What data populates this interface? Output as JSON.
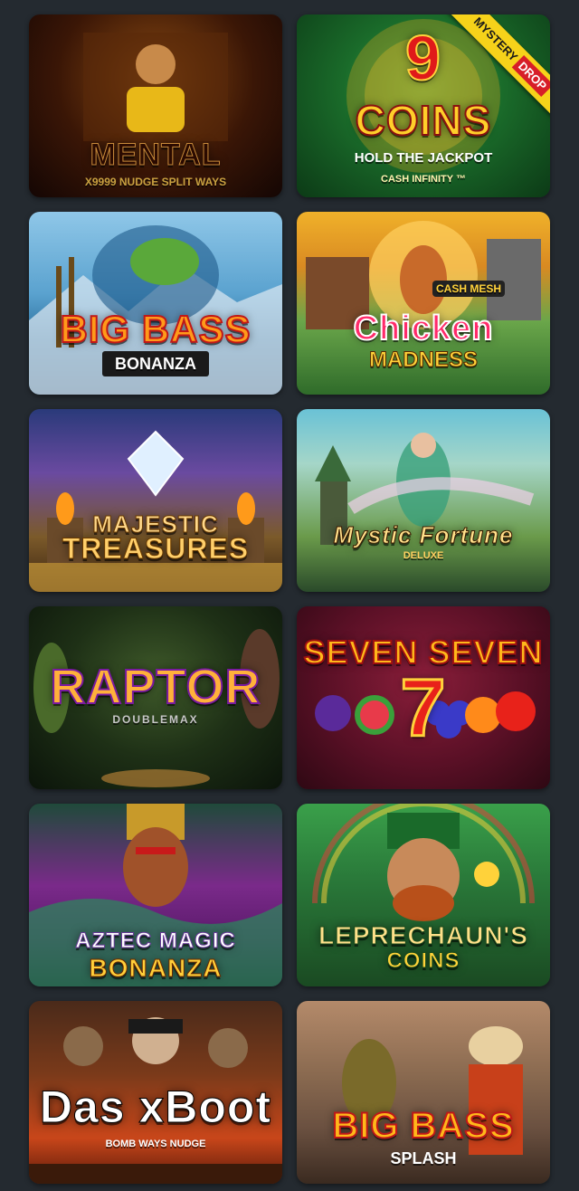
{
  "games": [
    {
      "title": "MENTAL",
      "sub": "X9999  NUDGE  SPLIT  WAYS"
    },
    {
      "title": "COINS",
      "badge_number": "9",
      "sub": "HOLD THE JACKPOT",
      "sub2": "CASH INFINITY ™",
      "ribbon_a": "MYSTERY ",
      "ribbon_b": "DROP"
    },
    {
      "title": "BIG BASS",
      "sub": "BONANZA"
    },
    {
      "title": "Chicken",
      "sub": "MADNESS",
      "sub2": "CASH MESH"
    },
    {
      "title": "MAJESTIC",
      "sub": "TREASURES"
    },
    {
      "title": "Mystic Fortune",
      "sub": "DELUXE"
    },
    {
      "title": "RAPTOR",
      "sub": "DOUBLEMAX"
    },
    {
      "title": "SEVEN SEVEN",
      "sub": "7"
    },
    {
      "title": "AZTEC MAGIC",
      "sub": "BONANZA"
    },
    {
      "title": "LEPRECHAUN'S",
      "sub": "COINS"
    },
    {
      "title": "Das xBoot",
      "sub": "BOMB  WAYS  NUDGE"
    },
    {
      "title": "BIG BASS",
      "sub": "SPLASH"
    }
  ]
}
